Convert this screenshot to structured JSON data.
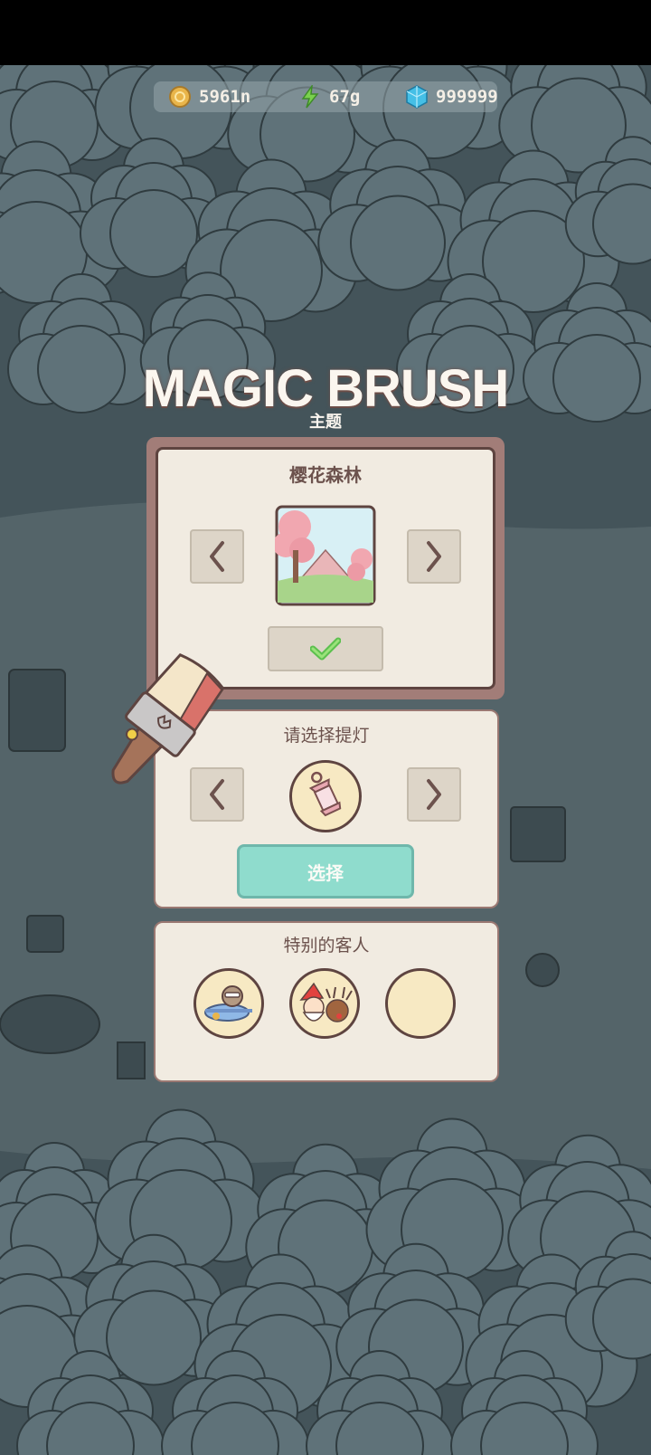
{
  "header": {
    "coins": "5961n",
    "energy": "67g",
    "gems": "999999"
  },
  "title": "MAGIC BRUSH",
  "subtitle": "主题",
  "theme_panel": {
    "name": "樱花森林"
  },
  "lantern_panel": {
    "heading": "请选择提灯",
    "select_label": "选择"
  },
  "guests_panel": {
    "heading": "特别的客人"
  },
  "colors": {
    "panel_bg": "#f1ebe1",
    "panel_border": "#9a7872",
    "accent_teal": "#8fdccd",
    "text_brown": "#6c524d"
  }
}
